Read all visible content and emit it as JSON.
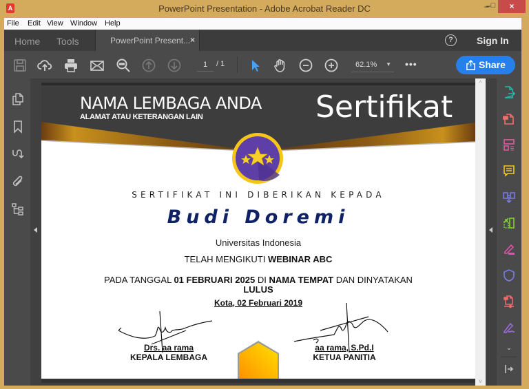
{
  "window": {
    "title": "PowerPoint Presentation - Adobe Acrobat Reader DC",
    "app_icon": "A",
    "minimize": "–",
    "maximize": "□",
    "close": "×"
  },
  "menu": [
    "File",
    "Edit",
    "View",
    "Window",
    "Help"
  ],
  "tabs": {
    "home": "Home",
    "tools": "Tools",
    "document": "PowerPoint Present...",
    "document_close": "×",
    "help": "?",
    "sign_in": "Sign In"
  },
  "toolbar": {
    "icons": [
      "save-icon",
      "upload-cloud-icon",
      "print-icon",
      "email-icon",
      "search-icon",
      "page-up-icon",
      "page-down-icon",
      "select-cursor-icon",
      "hand-tool-icon",
      "zoom-out-icon",
      "zoom-in-icon",
      "more-icon"
    ],
    "current_page": "1",
    "total_pages": "/ 1",
    "zoom_level": "62.1%",
    "zoom_caret": "▼",
    "more": "•••",
    "share": "Share"
  },
  "left_nav": [
    "page-thumbnails-icon",
    "bookmarks-icon",
    "signatures-icon",
    "attachments-icon",
    "content-tree-icon"
  ],
  "right_tools": {
    "items": [
      {
        "name": "export-pdf-icon",
        "color": "#2ab5a8"
      },
      {
        "name": "create-pdf-icon",
        "color": "#ef6d6d"
      },
      {
        "name": "edit-pdf-icon",
        "color": "#e05ba0"
      },
      {
        "name": "comment-icon",
        "color": "#f2c81a"
      },
      {
        "name": "combine-files-icon",
        "color": "#7c7ce8"
      },
      {
        "name": "organize-pages-icon",
        "color": "#7fd12f"
      },
      {
        "name": "fill-sign-icon",
        "color": "#e052a8"
      },
      {
        "name": "protect-icon",
        "color": "#7a7ae0"
      },
      {
        "name": "optimize-pdf-icon",
        "color": "#ef6d6d"
      },
      {
        "name": "send-for-signature-icon",
        "color": "#9a6ae0"
      }
    ],
    "more": "⌄",
    "collapse": "⇥"
  },
  "certificate": {
    "org_name": "NAMA LEMBAGA ANDA",
    "org_address": "ALAMAT ATAU KETERANGAN LAIN",
    "title": "Sertifikat",
    "given_to": "SERTIFIKAT INI DIBERIKAN KEPADA",
    "recipient": "Budi Doremi",
    "institution": "Universitas Indonesia",
    "attended_prefix": "TELAH MENGIKUTI ",
    "attended_event": "WEBINAR ABC",
    "date_prefix": "PADA TANGGAL ",
    "date_value": "01 FEBRUARI 2025",
    "date_mid": " DI ",
    "place": "NAMA TEMPAT",
    "date_suffix": " DAN DINYATAKAN ",
    "result": "LULUS",
    "place_date": "Kota, 02 Februari 2019",
    "signer_left_name": "Drs. aa rama",
    "signer_left_role": "KEPALA LEMBAGA",
    "signer_right_name": "aa rama, S.Pd.I",
    "signer_right_role": "KETUA PANITIA",
    "colors": {
      "header_dark": "#3d3d3d",
      "gold": "#c8901c",
      "medal_purple": "#5e3fa8",
      "medal_ring": "#f5c518",
      "recipient": "#102266"
    }
  },
  "scrollbar": {
    "up": "^",
    "down": "v"
  }
}
